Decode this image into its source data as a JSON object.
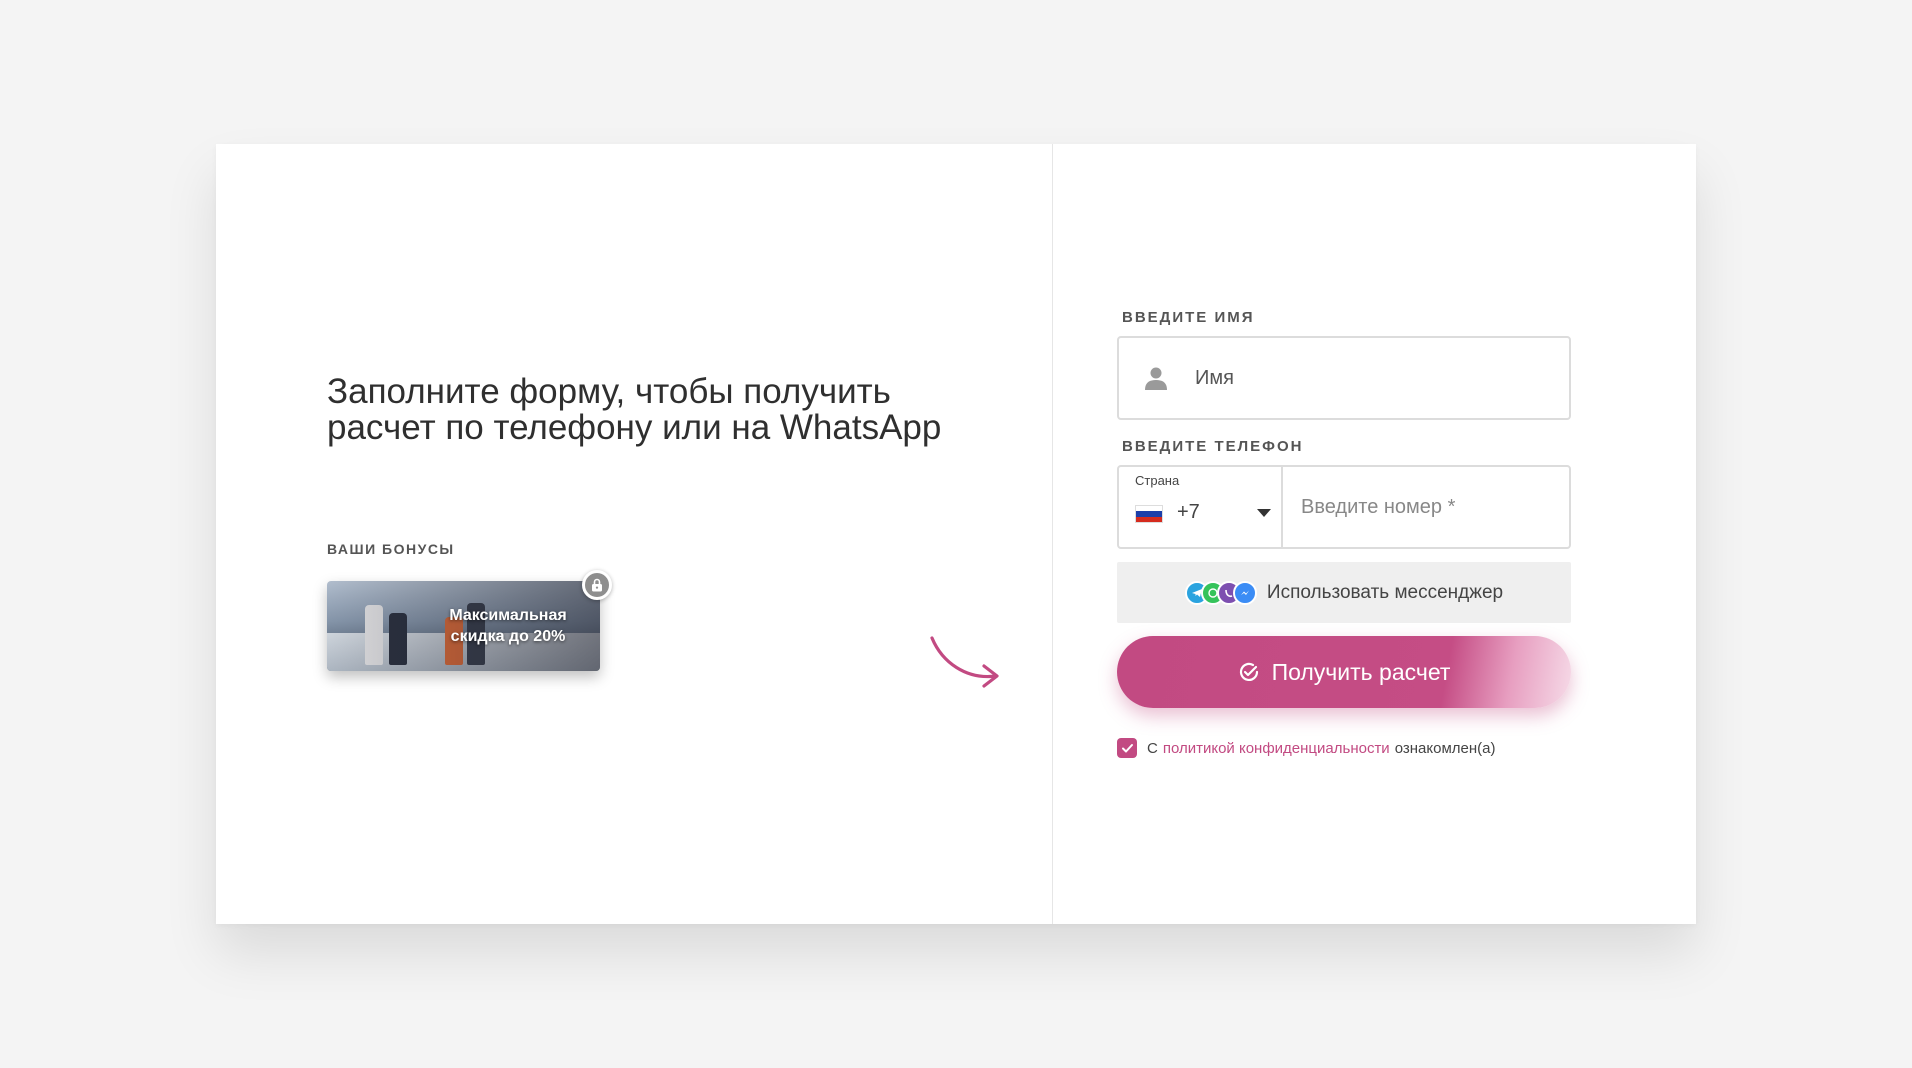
{
  "headline": "Заполните форму, чтобы получить расчет по телефону или на WhatsApp",
  "bonuses": {
    "label": "ВАШИ БОНУСЫ",
    "card_text": "Максимальная скидка до 20%",
    "lock_icon": "lock-icon"
  },
  "form": {
    "name_label": "ВВЕДИТЕ ИМЯ",
    "name_placeholder": "Имя",
    "phone_label": "ВВЕДИТЕ ТЕЛЕФОН",
    "country_caption": "Страна",
    "country_code": "+7",
    "phone_placeholder": "Введите номер *",
    "messenger_button": "Использовать мессенджер",
    "submit_button": "Получить расчет",
    "consent": {
      "prefix": "С",
      "link": "политикой конфиденциальности",
      "suffix": "ознакомлен(а)",
      "checked": true
    }
  },
  "colors": {
    "accent": "#c24a82",
    "background": "#f4f4f4",
    "card": "#ffffff",
    "messenger_bg": "#efefef"
  }
}
